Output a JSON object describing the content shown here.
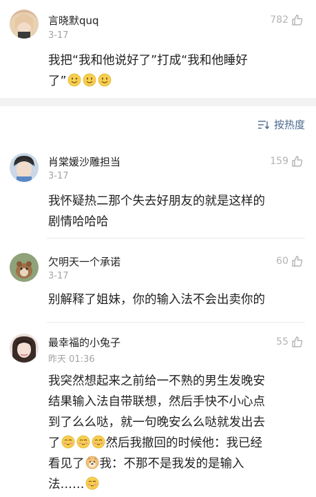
{
  "top_post": {
    "username": "言晓默quq",
    "date": "3-17",
    "likes": "782",
    "text_line1": "我把“我和他说好了”打成“我和他睡好",
    "text_line2": "了”"
  },
  "sort": {
    "label": "按热度"
  },
  "comments": [
    {
      "username": "肖棠媛沙雕担当",
      "date": "3-17",
      "likes": "159",
      "line1": "我怀疑热二那个失去好朋友的就是这样的",
      "line2": "剧情哈哈哈"
    },
    {
      "username": "欠明天一个承诺",
      "date": "3-17",
      "likes": "60",
      "line1": "别解释了姐妹，你的输入法不会出卖你的"
    },
    {
      "username": "最幸福的小兔子",
      "date": "昨天 01:36",
      "likes": "55",
      "line1": "我突然想起来之前给一不熟的男生发晚安",
      "line2": "结果输入法自带联想，然后手快不小心点",
      "line3": "到了么么哒，就一句晚安么么哒就发出去",
      "line4a": "了",
      "line4b": "然后我撤回的时候他：我已经",
      "line5a": "看见了",
      "line5b": "我：不那不是我发的是输入",
      "line6": "法……"
    }
  ]
}
